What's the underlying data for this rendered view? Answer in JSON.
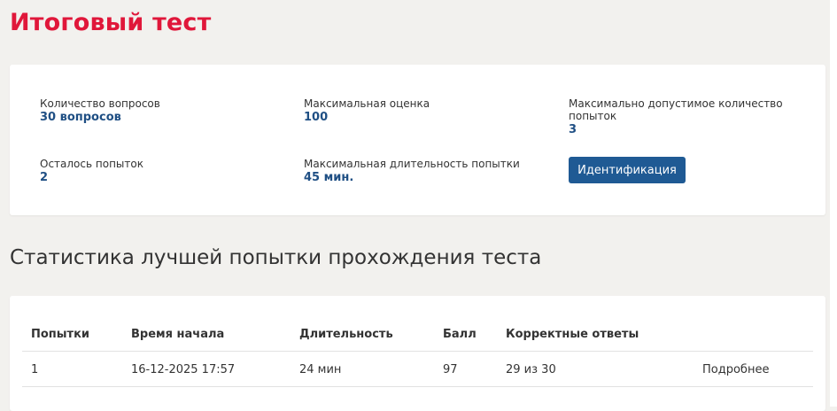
{
  "page": {
    "title": "Итоговый тест"
  },
  "info": {
    "question_count": {
      "label": "Количество вопросов",
      "value": "30 вопросов"
    },
    "max_score": {
      "label": "Максимальная оценка",
      "value": "100"
    },
    "max_attempts": {
      "label_line1": "Максимально допустимое количество",
      "label_line2": "попыток",
      "value": "3"
    },
    "attempts_left": {
      "label": "Осталось попыток",
      "value": "2"
    },
    "max_duration": {
      "label": "Максимальная длительность попытки",
      "value": "45 мин."
    },
    "identification_button": "Идентификация"
  },
  "stats": {
    "title": "Статистика лучшей попытки прохождения теста",
    "headers": {
      "attempt": "Попытки",
      "start_time": "Время начала",
      "duration": "Длительность",
      "score": "Балл",
      "correct": "Корректные ответы"
    },
    "rows": [
      {
        "attempt": "1",
        "start_time": "16-12-2025 17:57",
        "duration": "24 мин",
        "score": "97",
        "correct": "29 из 30",
        "details": "Подробнее"
      }
    ]
  },
  "colors": {
    "title_red": "#e0173a",
    "value_blue": "#1f4f84",
    "button_blue": "#1f5a94",
    "page_bg": "#f2f1ee"
  }
}
